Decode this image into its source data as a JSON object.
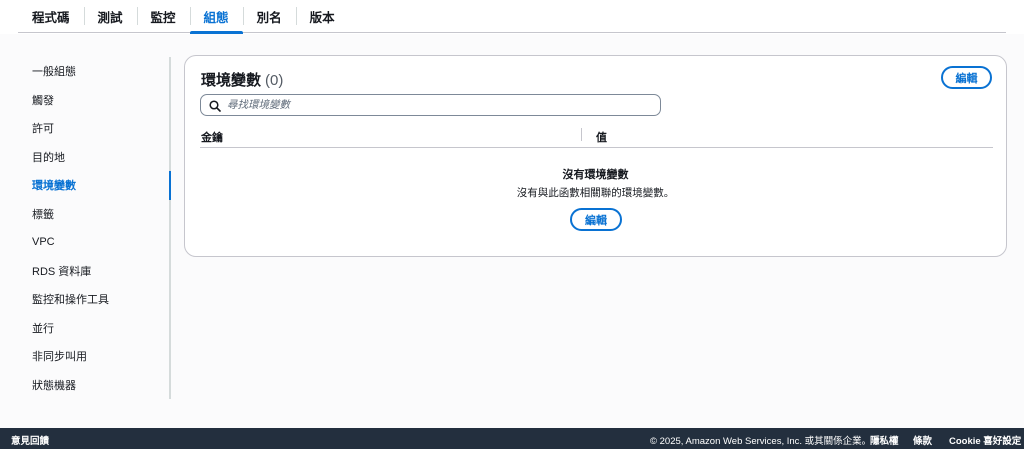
{
  "tabs": [
    {
      "label": "程式碼",
      "active": false
    },
    {
      "label": "測試",
      "active": false
    },
    {
      "label": "監控",
      "active": false
    },
    {
      "label": "組態",
      "active": true
    },
    {
      "label": "別名",
      "active": false
    },
    {
      "label": "版本",
      "active": false
    }
  ],
  "sidebar": {
    "items": [
      {
        "label": "一般組態"
      },
      {
        "label": "觸發"
      },
      {
        "label": "許可"
      },
      {
        "label": "目的地"
      },
      {
        "label": "環境變數",
        "active": true
      },
      {
        "label": "標籤"
      },
      {
        "label": "VPC"
      },
      {
        "label": "RDS 資料庫"
      },
      {
        "label": "監控和操作工具"
      },
      {
        "label": "並行"
      },
      {
        "label": "非同步叫用"
      },
      {
        "label": "狀態機器"
      }
    ]
  },
  "panel": {
    "title": "環境變數",
    "count": "(0)",
    "edit_label": "編輯",
    "search_placeholder": "尋找環境變數",
    "columns": {
      "key": "金鑰",
      "value": "值"
    },
    "empty_title": "沒有環境變數",
    "empty_desc": "沒有與此函數相關聯的環境變數。",
    "empty_edit_label": "編輯"
  },
  "footer": {
    "feedback": "意見回饋",
    "copyright": "© 2025, Amazon Web Services, Inc. 或其關係企業。",
    "privacy": "隱私權",
    "terms": "條款",
    "cookie": "Cookie 喜好設定"
  },
  "colors": {
    "accent": "#0972d3",
    "footer_bg": "#232f3e",
    "border": "#c6c6cd"
  },
  "icons": {
    "search": "search-icon"
  }
}
